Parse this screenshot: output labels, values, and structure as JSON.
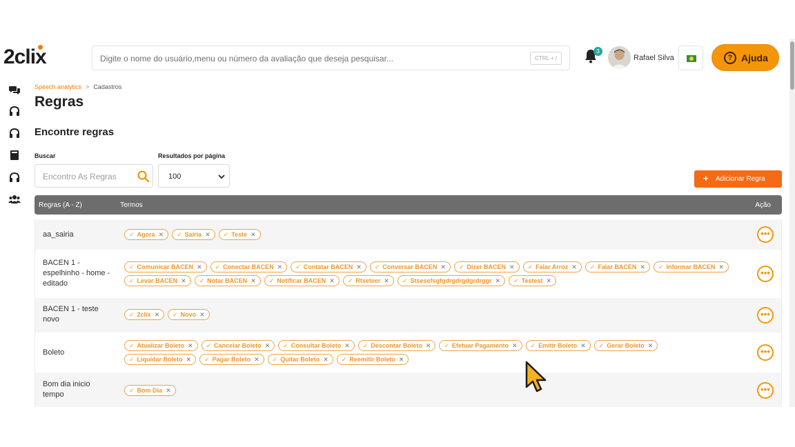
{
  "header": {
    "logo_text": "2clix",
    "search_placeholder": "Digite o nome do usuário,menu ou número da avaliação que deseja pesquisar...",
    "search_shortcut": "CTRL + /",
    "notification_count": "3",
    "user_name": "Rafael Silva",
    "help_label": "Ajuda"
  },
  "breadcrumb": {
    "parent": "Speech analytics",
    "separator": ">",
    "current": "Cadastros"
  },
  "page": {
    "title": "Regras",
    "section_title": "Encontre regras"
  },
  "filters": {
    "search_label": "Buscar",
    "search_placeholder": "Encontro As Regras",
    "results_label": "Resultados por página",
    "results_value": "100"
  },
  "add_button_label": "Adicionar Regra",
  "table": {
    "columns": [
      "Regras (A - Z)",
      "Termos",
      "Ação"
    ],
    "rows": [
      {
        "name": "aa_sairia",
        "terms": [
          "Agora",
          "Sairia",
          "Teste"
        ]
      },
      {
        "name": "BACEN 1 - espelhinho - home - editado",
        "terms": [
          "Comunicar BACEN",
          "Conectar BACEN",
          "Contatar BACEN",
          "Conversar BACEN",
          "Dizer BACEN",
          "Falar Arroz",
          "Falar BACEN",
          "Informar BACEN",
          "Levar BACEN",
          "Notar BACEN",
          "Notificar BACEN",
          "Rtseteer",
          "Stsesefsgfgdrgdrgdgrdrggr",
          "Testest"
        ]
      },
      {
        "name": "BACEN 1 - teste novo",
        "terms": [
          "2clix",
          "Novo"
        ]
      },
      {
        "name": "Boleto",
        "terms": [
          "Atualizar Boleto",
          "Cancelar Boleto",
          "Consultar Boleto",
          "Descontar Boleto",
          "Efetuar Pagamento",
          "Emitir Boleto",
          "Gerar Boleto",
          "Liquidar Boleto",
          "Pagar Boleto",
          "Quitar Boleto",
          "Reemitir Boleto"
        ]
      },
      {
        "name": "Bom dia inicio tempo",
        "terms": [
          "Bom Dia"
        ]
      }
    ]
  },
  "colors": {
    "accent": "#f5960a",
    "button_orange": "#f56a14",
    "chip_border": "#f0a243",
    "table_header": "#6d6d6d"
  }
}
